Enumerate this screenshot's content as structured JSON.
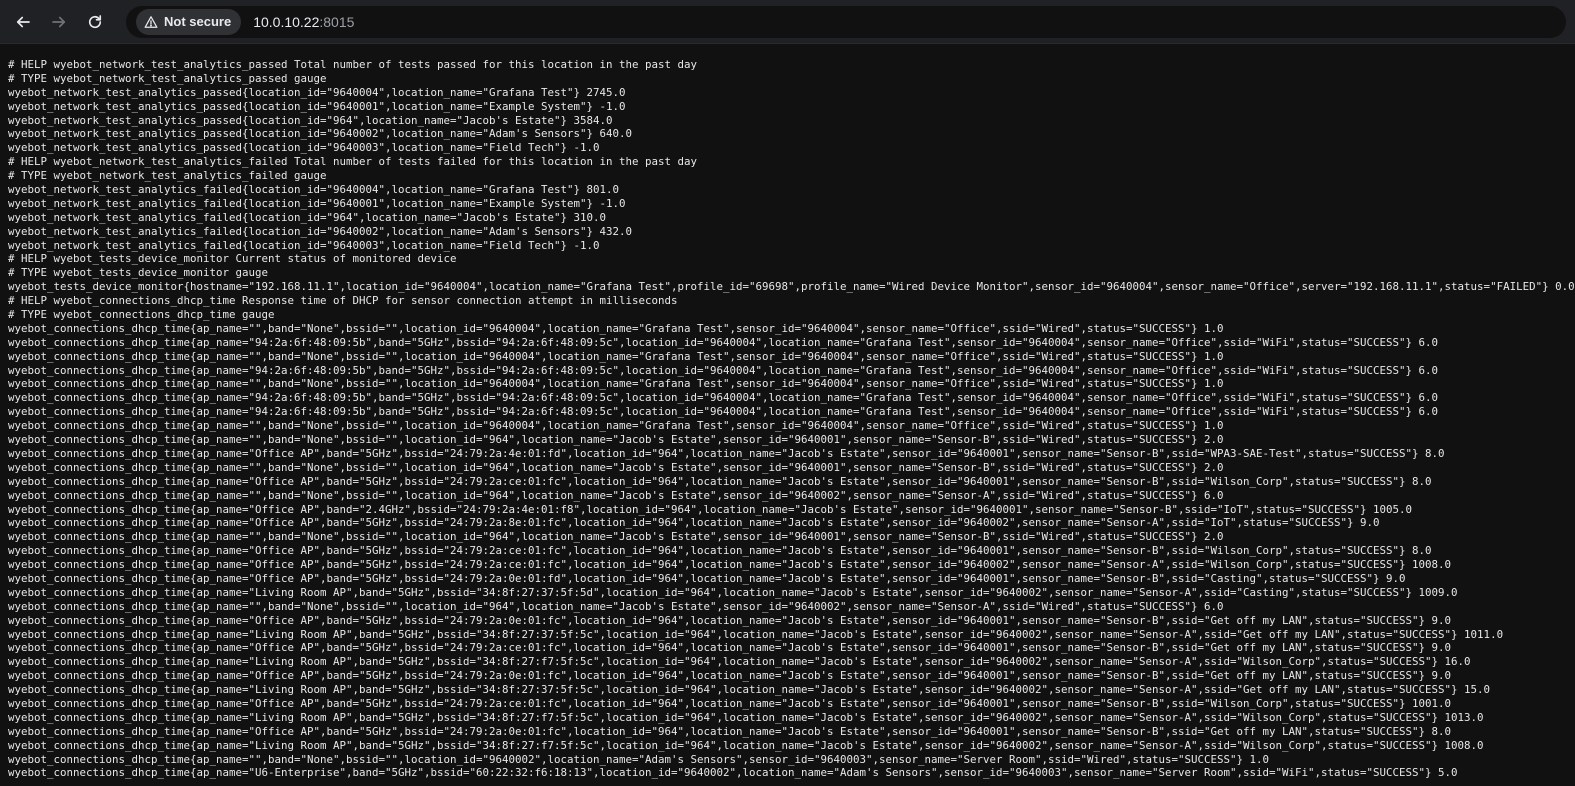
{
  "browser": {
    "security_label": "Not secure",
    "url_host": "10.0.10.22",
    "url_port": ":8015"
  },
  "lines": [
    "# HELP wyebot_network_test_analytics_passed Total number of tests passed for this location in the past day",
    "# TYPE wyebot_network_test_analytics_passed gauge",
    "wyebot_network_test_analytics_passed{location_id=\"9640004\",location_name=\"Grafana Test\"} 2745.0",
    "wyebot_network_test_analytics_passed{location_id=\"9640001\",location_name=\"Example System\"} -1.0",
    "wyebot_network_test_analytics_passed{location_id=\"964\",location_name=\"Jacob's Estate\"} 3584.0",
    "wyebot_network_test_analytics_passed{location_id=\"9640002\",location_name=\"Adam's Sensors\"} 640.0",
    "wyebot_network_test_analytics_passed{location_id=\"9640003\",location_name=\"Field Tech\"} -1.0",
    "# HELP wyebot_network_test_analytics_failed Total number of tests failed for this location in the past day",
    "# TYPE wyebot_network_test_analytics_failed gauge",
    "wyebot_network_test_analytics_failed{location_id=\"9640004\",location_name=\"Grafana Test\"} 801.0",
    "wyebot_network_test_analytics_failed{location_id=\"9640001\",location_name=\"Example System\"} -1.0",
    "wyebot_network_test_analytics_failed{location_id=\"964\",location_name=\"Jacob's Estate\"} 310.0",
    "wyebot_network_test_analytics_failed{location_id=\"9640002\",location_name=\"Adam's Sensors\"} 432.0",
    "wyebot_network_test_analytics_failed{location_id=\"9640003\",location_name=\"Field Tech\"} -1.0",
    "# HELP wyebot_tests_device_monitor Current status of monitored device",
    "# TYPE wyebot_tests_device_monitor gauge",
    "wyebot_tests_device_monitor{hostname=\"192.168.11.1\",location_id=\"9640004\",location_name=\"Grafana Test\",profile_id=\"69698\",profile_name=\"Wired Device Monitor\",sensor_id=\"9640004\",sensor_name=\"Office\",server=\"192.168.11.1\",status=\"FAILED\"} 0.0",
    "# HELP wyebot_connections_dhcp_time Response time of DHCP for sensor connection attempt in milliseconds",
    "# TYPE wyebot_connections_dhcp_time gauge",
    "wyebot_connections_dhcp_time{ap_name=\"\",band=\"None\",bssid=\"\",location_id=\"9640004\",location_name=\"Grafana Test\",sensor_id=\"9640004\",sensor_name=\"Office\",ssid=\"Wired\",status=\"SUCCESS\"} 1.0",
    "wyebot_connections_dhcp_time{ap_name=\"94:2a:6f:48:09:5b\",band=\"5GHz\",bssid=\"94:2a:6f:48:09:5c\",location_id=\"9640004\",location_name=\"Grafana Test\",sensor_id=\"9640004\",sensor_name=\"Office\",ssid=\"WiFi\",status=\"SUCCESS\"} 6.0",
    "wyebot_connections_dhcp_time{ap_name=\"\",band=\"None\",bssid=\"\",location_id=\"9640004\",location_name=\"Grafana Test\",sensor_id=\"9640004\",sensor_name=\"Office\",ssid=\"Wired\",status=\"SUCCESS\"} 1.0",
    "wyebot_connections_dhcp_time{ap_name=\"94:2a:6f:48:09:5b\",band=\"5GHz\",bssid=\"94:2a:6f:48:09:5c\",location_id=\"9640004\",location_name=\"Grafana Test\",sensor_id=\"9640004\",sensor_name=\"Office\",ssid=\"WiFi\",status=\"SUCCESS\"} 6.0",
    "wyebot_connections_dhcp_time{ap_name=\"\",band=\"None\",bssid=\"\",location_id=\"9640004\",location_name=\"Grafana Test\",sensor_id=\"9640004\",sensor_name=\"Office\",ssid=\"Wired\",status=\"SUCCESS\"} 1.0",
    "wyebot_connections_dhcp_time{ap_name=\"94:2a:6f:48:09:5b\",band=\"5GHz\",bssid=\"94:2a:6f:48:09:5c\",location_id=\"9640004\",location_name=\"Grafana Test\",sensor_id=\"9640004\",sensor_name=\"Office\",ssid=\"WiFi\",status=\"SUCCESS\"} 6.0",
    "wyebot_connections_dhcp_time{ap_name=\"94:2a:6f:48:09:5b\",band=\"5GHz\",bssid=\"94:2a:6f:48:09:5c\",location_id=\"9640004\",location_name=\"Grafana Test\",sensor_id=\"9640004\",sensor_name=\"Office\",ssid=\"WiFi\",status=\"SUCCESS\"} 6.0",
    "wyebot_connections_dhcp_time{ap_name=\"\",band=\"None\",bssid=\"\",location_id=\"9640004\",location_name=\"Grafana Test\",sensor_id=\"9640004\",sensor_name=\"Office\",ssid=\"Wired\",status=\"SUCCESS\"} 1.0",
    "wyebot_connections_dhcp_time{ap_name=\"\",band=\"None\",bssid=\"\",location_id=\"964\",location_name=\"Jacob's Estate\",sensor_id=\"9640001\",sensor_name=\"Sensor-B\",ssid=\"Wired\",status=\"SUCCESS\"} 2.0",
    "wyebot_connections_dhcp_time{ap_name=\"Office AP\",band=\"5GHz\",bssid=\"24:79:2a:4e:01:fd\",location_id=\"964\",location_name=\"Jacob's Estate\",sensor_id=\"9640001\",sensor_name=\"Sensor-B\",ssid=\"WPA3-SAE-Test\",status=\"SUCCESS\"} 8.0",
    "wyebot_connections_dhcp_time{ap_name=\"\",band=\"None\",bssid=\"\",location_id=\"964\",location_name=\"Jacob's Estate\",sensor_id=\"9640001\",sensor_name=\"Sensor-B\",ssid=\"Wired\",status=\"SUCCESS\"} 2.0",
    "wyebot_connections_dhcp_time{ap_name=\"Office AP\",band=\"5GHz\",bssid=\"24:79:2a:ce:01:fc\",location_id=\"964\",location_name=\"Jacob's Estate\",sensor_id=\"9640001\",sensor_name=\"Sensor-B\",ssid=\"Wilson_Corp\",status=\"SUCCESS\"} 8.0",
    "wyebot_connections_dhcp_time{ap_name=\"\",band=\"None\",bssid=\"\",location_id=\"964\",location_name=\"Jacob's Estate\",sensor_id=\"9640002\",sensor_name=\"Sensor-A\",ssid=\"Wired\",status=\"SUCCESS\"} 6.0",
    "wyebot_connections_dhcp_time{ap_name=\"Office AP\",band=\"2.4GHz\",bssid=\"24:79:2a:4e:01:f8\",location_id=\"964\",location_name=\"Jacob's Estate\",sensor_id=\"9640001\",sensor_name=\"Sensor-B\",ssid=\"IoT\",status=\"SUCCESS\"} 1005.0",
    "wyebot_connections_dhcp_time{ap_name=\"Office AP\",band=\"5GHz\",bssid=\"24:79:2a:8e:01:fc\",location_id=\"964\",location_name=\"Jacob's Estate\",sensor_id=\"9640002\",sensor_name=\"Sensor-A\",ssid=\"IoT\",status=\"SUCCESS\"} 9.0",
    "wyebot_connections_dhcp_time{ap_name=\"\",band=\"None\",bssid=\"\",location_id=\"964\",location_name=\"Jacob's Estate\",sensor_id=\"9640001\",sensor_name=\"Sensor-B\",ssid=\"Wired\",status=\"SUCCESS\"} 2.0",
    "wyebot_connections_dhcp_time{ap_name=\"Office AP\",band=\"5GHz\",bssid=\"24:79:2a:ce:01:fc\",location_id=\"964\",location_name=\"Jacob's Estate\",sensor_id=\"9640001\",sensor_name=\"Sensor-B\",ssid=\"Wilson_Corp\",status=\"SUCCESS\"} 8.0",
    "wyebot_connections_dhcp_time{ap_name=\"Office AP\",band=\"5GHz\",bssid=\"24:79:2a:ce:01:fc\",location_id=\"964\",location_name=\"Jacob's Estate\",sensor_id=\"9640002\",sensor_name=\"Sensor-A\",ssid=\"Wilson_Corp\",status=\"SUCCESS\"} 1008.0",
    "wyebot_connections_dhcp_time{ap_name=\"Office AP\",band=\"5GHz\",bssid=\"24:79:2a:0e:01:fd\",location_id=\"964\",location_name=\"Jacob's Estate\",sensor_id=\"9640001\",sensor_name=\"Sensor-B\",ssid=\"Casting\",status=\"SUCCESS\"} 9.0",
    "wyebot_connections_dhcp_time{ap_name=\"Living Room AP\",band=\"5GHz\",bssid=\"34:8f:27:37:5f:5d\",location_id=\"964\",location_name=\"Jacob's Estate\",sensor_id=\"9640002\",sensor_name=\"Sensor-A\",ssid=\"Casting\",status=\"SUCCESS\"} 1009.0",
    "wyebot_connections_dhcp_time{ap_name=\"\",band=\"None\",bssid=\"\",location_id=\"964\",location_name=\"Jacob's Estate\",sensor_id=\"9640002\",sensor_name=\"Sensor-A\",ssid=\"Wired\",status=\"SUCCESS\"} 6.0",
    "wyebot_connections_dhcp_time{ap_name=\"Office AP\",band=\"5GHz\",bssid=\"24:79:2a:0e:01:fc\",location_id=\"964\",location_name=\"Jacob's Estate\",sensor_id=\"9640001\",sensor_name=\"Sensor-B\",ssid=\"Get off my LAN\",status=\"SUCCESS\"} 9.0",
    "wyebot_connections_dhcp_time{ap_name=\"Living Room AP\",band=\"5GHz\",bssid=\"34:8f:27:37:5f:5c\",location_id=\"964\",location_name=\"Jacob's Estate\",sensor_id=\"9640002\",sensor_name=\"Sensor-A\",ssid=\"Get off my LAN\",status=\"SUCCESS\"} 1011.0",
    "wyebot_connections_dhcp_time{ap_name=\"Office AP\",band=\"5GHz\",bssid=\"24:79:2a:ce:01:fc\",location_id=\"964\",location_name=\"Jacob's Estate\",sensor_id=\"9640001\",sensor_name=\"Sensor-B\",ssid=\"Get off my LAN\",status=\"SUCCESS\"} 9.0",
    "wyebot_connections_dhcp_time{ap_name=\"Living Room AP\",band=\"5GHz\",bssid=\"34:8f:27:f7:5f:5c\",location_id=\"964\",location_name=\"Jacob's Estate\",sensor_id=\"9640002\",sensor_name=\"Sensor-A\",ssid=\"Wilson_Corp\",status=\"SUCCESS\"} 16.0",
    "wyebot_connections_dhcp_time{ap_name=\"Office AP\",band=\"5GHz\",bssid=\"24:79:2a:0e:01:fc\",location_id=\"964\",location_name=\"Jacob's Estate\",sensor_id=\"9640001\",sensor_name=\"Sensor-B\",ssid=\"Get off my LAN\",status=\"SUCCESS\"} 9.0",
    "wyebot_connections_dhcp_time{ap_name=\"Living Room AP\",band=\"5GHz\",bssid=\"34:8f:27:37:5f:5c\",location_id=\"964\",location_name=\"Jacob's Estate\",sensor_id=\"9640002\",sensor_name=\"Sensor-A\",ssid=\"Get off my LAN\",status=\"SUCCESS\"} 15.0",
    "wyebot_connections_dhcp_time{ap_name=\"Office AP\",band=\"5GHz\",bssid=\"24:79:2a:ce:01:fc\",location_id=\"964\",location_name=\"Jacob's Estate\",sensor_id=\"9640001\",sensor_name=\"Sensor-B\",ssid=\"Wilson_Corp\",status=\"SUCCESS\"} 1001.0",
    "wyebot_connections_dhcp_time{ap_name=\"Living Room AP\",band=\"5GHz\",bssid=\"34:8f:27:f7:5f:5c\",location_id=\"964\",location_name=\"Jacob's Estate\",sensor_id=\"9640002\",sensor_name=\"Sensor-A\",ssid=\"Wilson_Corp\",status=\"SUCCESS\"} 1013.0",
    "wyebot_connections_dhcp_time{ap_name=\"Office AP\",band=\"5GHz\",bssid=\"24:79:2a:0e:01:fc\",location_id=\"964\",location_name=\"Jacob's Estate\",sensor_id=\"9640001\",sensor_name=\"Sensor-B\",ssid=\"Get off my LAN\",status=\"SUCCESS\"} 8.0",
    "wyebot_connections_dhcp_time{ap_name=\"Living Room AP\",band=\"5GHz\",bssid=\"34:8f:27:f7:5f:5c\",location_id=\"964\",location_name=\"Jacob's Estate\",sensor_id=\"9640002\",sensor_name=\"Sensor-A\",ssid=\"Wilson_Corp\",status=\"SUCCESS\"} 1008.0",
    "wyebot_connections_dhcp_time{ap_name=\"\",band=\"None\",bssid=\"\",location_id=\"9640002\",location_name=\"Adam's Sensors\",sensor_id=\"9640003\",sensor_name=\"Server Room\",ssid=\"Wired\",status=\"SUCCESS\"} 1.0",
    "wyebot_connections_dhcp_time{ap_name=\"U6-Enterprise\",band=\"5GHz\",bssid=\"60:22:32:f6:18:13\",location_id=\"9640002\",location_name=\"Adam's Sensors\",sensor_id=\"9640003\",sensor_name=\"Server Room\",ssid=\"WiFi\",status=\"SUCCESS\"} 5.0"
  ]
}
